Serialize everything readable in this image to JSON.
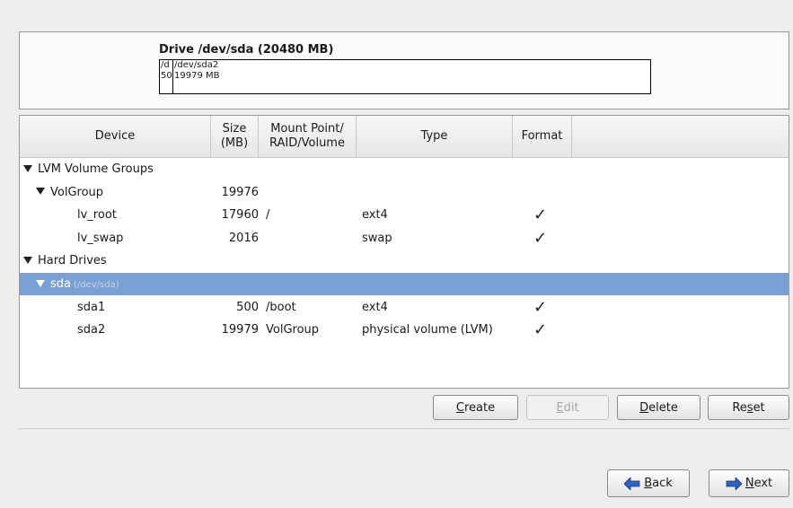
{
  "drive": {
    "title": "Drive /dev/sda (20480 MB)",
    "seg_small_line1": "/d",
    "seg_small_line2": "50",
    "seg_large_line1": "/dev/sda2",
    "seg_large_line2": "19979 MB"
  },
  "table": {
    "headers": {
      "device": "Device",
      "size_1": "Size",
      "size_2": "(MB)",
      "mount_1": "Mount Point/",
      "mount_2": "RAID/Volume",
      "type": "Type",
      "format": "Format"
    },
    "rows": [
      {
        "device": "LVM Volume Groups",
        "size": "",
        "mount": "",
        "type": "",
        "format": false,
        "expander": true,
        "indent": 0
      },
      {
        "device": "VolGroup",
        "size": "19976",
        "mount": "",
        "type": "",
        "format": false,
        "expander": true,
        "indent": 1
      },
      {
        "device": "lv_root",
        "size": "17960",
        "mount": "/",
        "type": "ext4",
        "format": true,
        "expander": false,
        "indent": 2
      },
      {
        "device": "lv_swap",
        "size": "2016",
        "mount": "",
        "type": "swap",
        "format": true,
        "expander": false,
        "indent": 2
      },
      {
        "device": "Hard Drives",
        "size": "",
        "mount": "",
        "type": "",
        "format": false,
        "expander": true,
        "indent": 0
      },
      {
        "device": "sda",
        "sub": "(/dev/sda)",
        "size": "",
        "mount": "",
        "type": "",
        "format": false,
        "expander": true,
        "indent": 1,
        "selected": true
      },
      {
        "device": "sda1",
        "size": "500",
        "mount": "/boot",
        "type": "ext4",
        "format": true,
        "expander": false,
        "indent": 2
      },
      {
        "device": "sda2",
        "size": "19979",
        "mount": "VolGroup",
        "type": "physical volume (LVM)",
        "format": true,
        "expander": false,
        "indent": 2
      }
    ],
    "check_glyph": "✓"
  },
  "actions": {
    "create_pre": "",
    "create_u": "C",
    "create_post": "reate",
    "edit_pre": "",
    "edit_u": "E",
    "edit_post": "dit",
    "delete_pre": "",
    "delete_u": "D",
    "delete_post": "elete",
    "reset_pre": "Re",
    "reset_u": "s",
    "reset_post": "et"
  },
  "nav": {
    "back_pre": "",
    "back_u": "B",
    "back_post": "ack",
    "next_pre": "",
    "next_u": "N",
    "next_post": "ext"
  },
  "colors": {
    "selection": "#7a9fd3",
    "arrow_blue": "#2e63c4"
  }
}
